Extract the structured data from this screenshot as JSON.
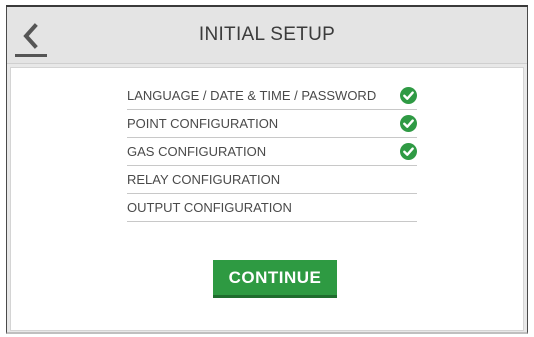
{
  "header": {
    "title": "INITIAL SETUP",
    "back_icon": "chevron-left-icon"
  },
  "steps": [
    {
      "label": "LANGUAGE / DATE & TIME / PASSWORD",
      "complete": true
    },
    {
      "label": "POINT CONFIGURATION",
      "complete": true
    },
    {
      "label": "GAS CONFIGURATION",
      "complete": true
    },
    {
      "label": "RELAY CONFIGURATION",
      "complete": false
    },
    {
      "label": "OUTPUT CONFIGURATION",
      "complete": false
    }
  ],
  "continue_label": "CONTINUE",
  "colors": {
    "accent": "#2e9a42",
    "check": "#2f9a44"
  }
}
